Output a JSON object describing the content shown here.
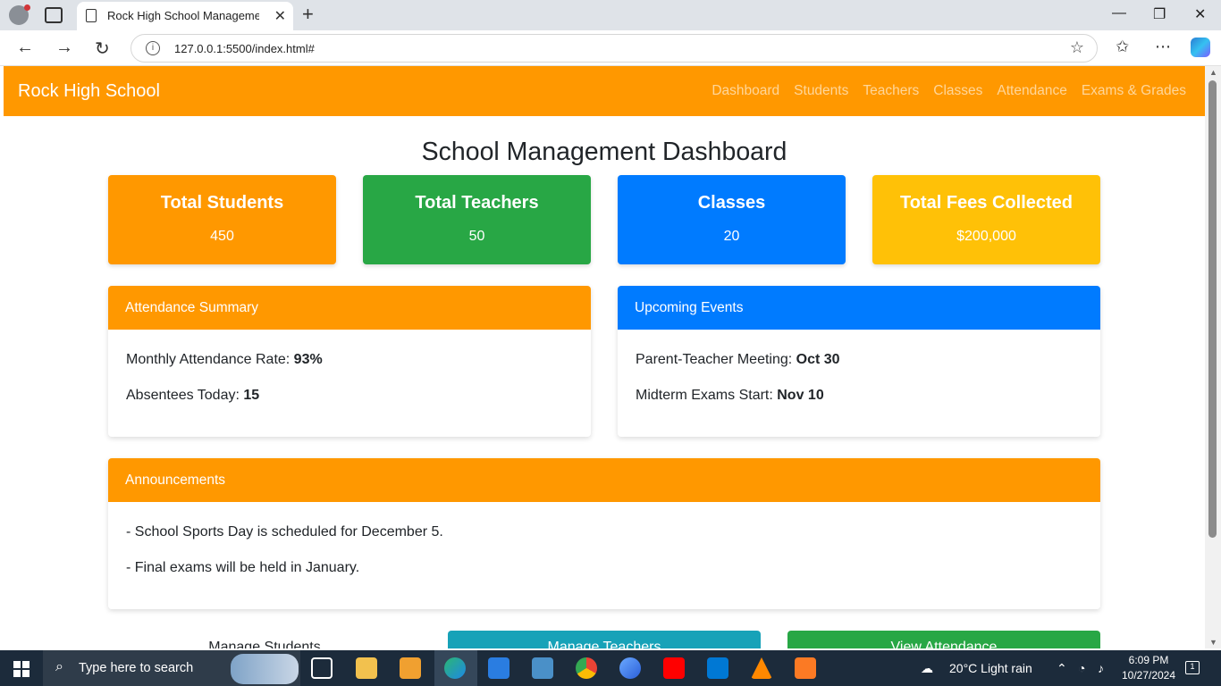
{
  "browser": {
    "tab_title": "Rock High School Management -",
    "url": "127.0.0.1:5500/index.html#"
  },
  "site": {
    "brand": "Rock High School",
    "nav": [
      "Dashboard",
      "Students",
      "Teachers",
      "Classes",
      "Attendance",
      "Exams & Grades"
    ],
    "page_title": "School Management Dashboard"
  },
  "stats": [
    {
      "label": "Total Students",
      "value": "450",
      "color": "#ff9800"
    },
    {
      "label": "Total Teachers",
      "value": "50",
      "color": "#28a745"
    },
    {
      "label": "Classes",
      "value": "20",
      "color": "#007bff"
    },
    {
      "label": "Total Fees Collected",
      "value": "$200,000",
      "color": "#ffc107"
    }
  ],
  "attendance": {
    "title": "Attendance Summary",
    "rate_label": "Monthly Attendance Rate: ",
    "rate_value": "93%",
    "absent_label": "Absentees Today: ",
    "absent_value": "15"
  },
  "events": {
    "title": "Upcoming Events",
    "e1_label": "Parent-Teacher Meeting: ",
    "e1_value": "Oct 30",
    "e2_label": "Midterm Exams Start: ",
    "e2_value": "Nov 10"
  },
  "announcements": {
    "title": "Announcements",
    "items": [
      "- School Sports Day is scheduled for December 5.",
      "- Final exams will be held in January."
    ]
  },
  "actions": {
    "manage_students": "Manage Students",
    "manage_teachers": "Manage Teachers",
    "view_attendance": "View Attendance"
  },
  "taskbar": {
    "search_placeholder": "Type here to search",
    "weather": "20°C  Light rain",
    "time": "6:09 PM",
    "date": "10/27/2024",
    "notifications": "1"
  },
  "colors": {
    "orange": "#ff9800",
    "green": "#28a745",
    "blue": "#007bff",
    "yellow": "#ffc107",
    "teal": "#17a2b8"
  }
}
